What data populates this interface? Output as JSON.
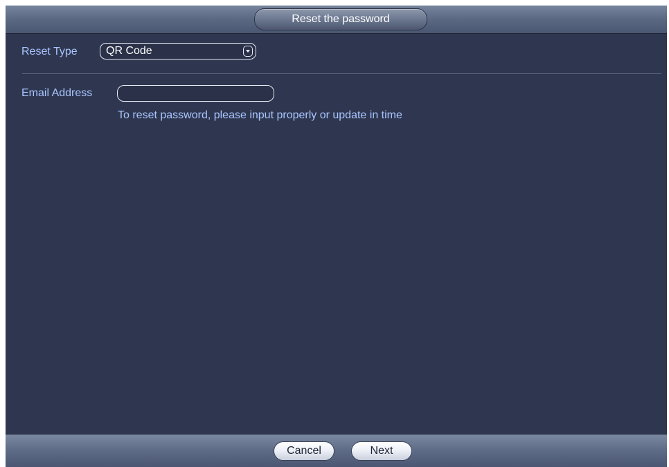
{
  "dialog": {
    "title": "Reset the password"
  },
  "form": {
    "reset_type_label": "Reset Type",
    "reset_type_value": "QR Code",
    "email_label": "Email Address",
    "email_value": "",
    "hint": "To reset password, please input properly or update in time"
  },
  "footer": {
    "cancel_label": "Cancel",
    "next_label": "Next"
  },
  "colors": {
    "background": "#2f3750",
    "label_text": "#a9c5ff",
    "bar": "#5a6882"
  },
  "icons": {
    "select_arrow": "chevron-down-icon"
  }
}
